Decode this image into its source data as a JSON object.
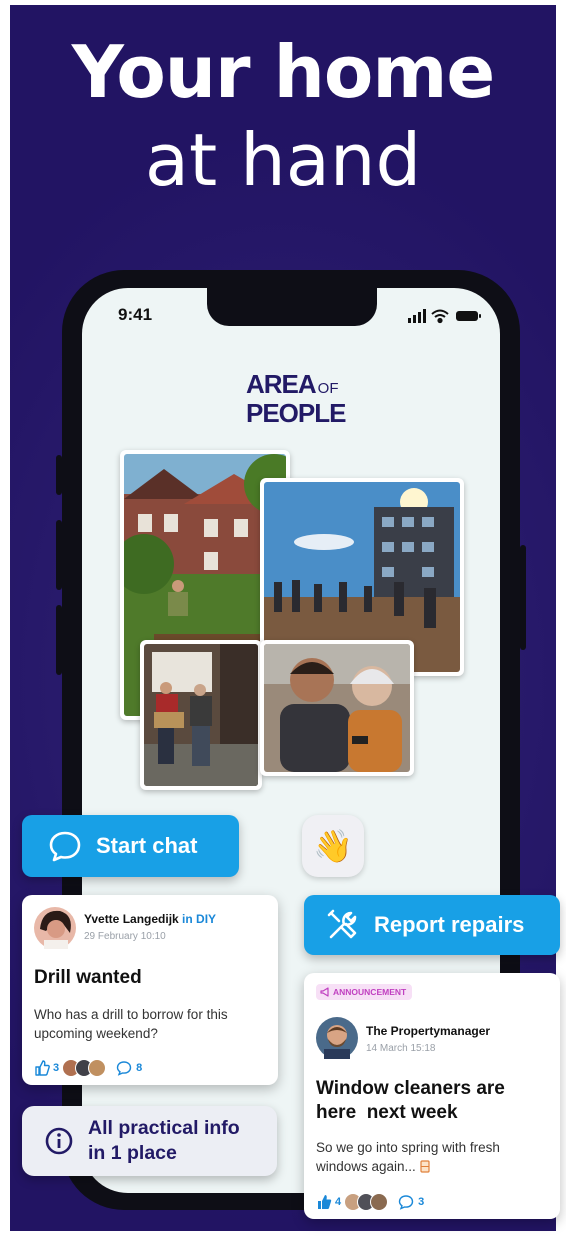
{
  "headline": {
    "line1": "Your home",
    "line2": "at hand"
  },
  "status": {
    "time": "9:41"
  },
  "logo": {
    "line1": "AREA",
    "of": "OF",
    "line2": "PEOPLE"
  },
  "actions": {
    "start_chat": "Start chat",
    "wave": "👋",
    "report_repairs": "Report repairs",
    "info": "All practical info in 1 place",
    "info_line1": "All practical info",
    "info_line2": "in 1 place"
  },
  "post1": {
    "author": "Yvette Langedijk",
    "in": "in DIY",
    "date": "29 February 10:10",
    "title": "Drill wanted",
    "body": "Who has a drill to borrow for this upcoming weekend?",
    "likes": "3",
    "comments": "8"
  },
  "post2": {
    "badge": "ANNOUNCEMENT",
    "author": "The Propertymanager",
    "date": "14 March 15:18",
    "title_line1": "Window cleaners are",
    "title_line2": "here  next week",
    "body": "So we go into spring with fresh windows again... ",
    "likes": "4",
    "comments": "3"
  },
  "colors": {
    "accent": "#18a0e6",
    "background": "#221463",
    "brand": "#221a66"
  }
}
